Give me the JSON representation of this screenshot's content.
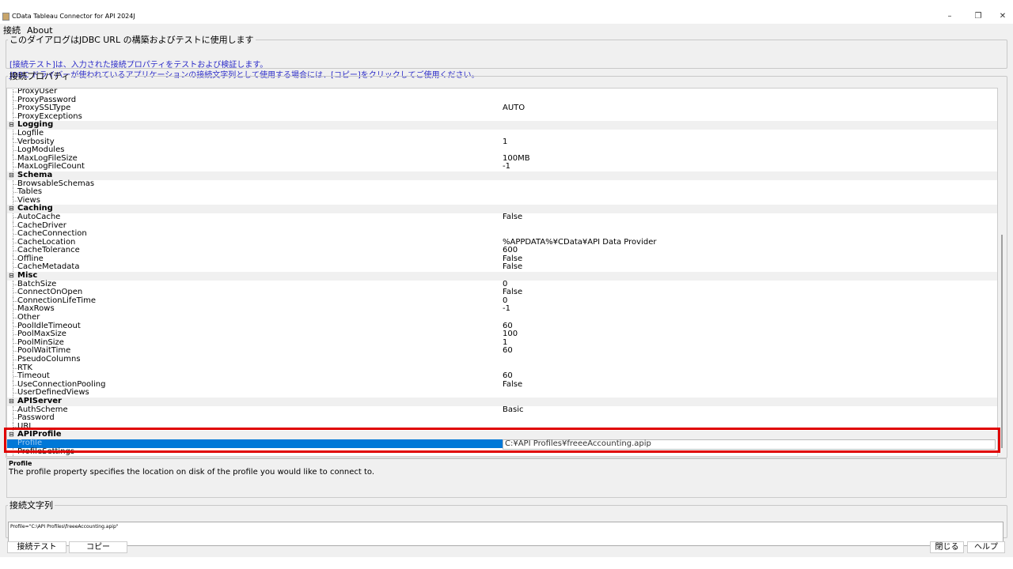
{
  "window": {
    "title": "CData Tableau Connector for API 2024J",
    "minimize": "–",
    "maximize": "❐",
    "close": "✕"
  },
  "menu": [
    "接続",
    "About"
  ],
  "info": {
    "legend": "このダイアログはJDBC URL の構築およびテストに使用します",
    "line1": "[接続テスト]は、入力された接続プロパティをテストおよび検証します。",
    "line2": "JDBC ドライバーが使われているアプリケーションの接続文字列として使用する場合には、[コピー]をクリックしてご使用ください。"
  },
  "properties": {
    "legend": "接続プロパティ",
    "rows": [
      {
        "name": "ProxyUser",
        "value": ""
      },
      {
        "name": "ProxyPassword",
        "value": ""
      },
      {
        "name": "ProxySSLType",
        "value": "AUTO"
      },
      {
        "name": "ProxyExceptions",
        "value": ""
      },
      {
        "name": "Logging",
        "category": true
      },
      {
        "name": "Logfile",
        "value": ""
      },
      {
        "name": "Verbosity",
        "value": "1"
      },
      {
        "name": "LogModules",
        "value": ""
      },
      {
        "name": "MaxLogFileSize",
        "value": "100MB"
      },
      {
        "name": "MaxLogFileCount",
        "value": "-1"
      },
      {
        "name": "Schema",
        "category": true
      },
      {
        "name": "BrowsableSchemas",
        "value": ""
      },
      {
        "name": "Tables",
        "value": ""
      },
      {
        "name": "Views",
        "value": ""
      },
      {
        "name": "Caching",
        "category": true
      },
      {
        "name": "AutoCache",
        "value": "False"
      },
      {
        "name": "CacheDriver",
        "value": ""
      },
      {
        "name": "CacheConnection",
        "value": ""
      },
      {
        "name": "CacheLocation",
        "value": "%APPDATA%¥CData¥API Data Provider"
      },
      {
        "name": "CacheTolerance",
        "value": "600"
      },
      {
        "name": "Offline",
        "value": "False"
      },
      {
        "name": "CacheMetadata",
        "value": "False"
      },
      {
        "name": "Misc",
        "category": true
      },
      {
        "name": "BatchSize",
        "value": "0"
      },
      {
        "name": "ConnectOnOpen",
        "value": "False"
      },
      {
        "name": "ConnectionLifeTime",
        "value": "0"
      },
      {
        "name": "MaxRows",
        "value": "-1"
      },
      {
        "name": "Other",
        "value": ""
      },
      {
        "name": "PoolIdleTimeout",
        "value": "60"
      },
      {
        "name": "PoolMaxSize",
        "value": "100"
      },
      {
        "name": "PoolMinSize",
        "value": "1"
      },
      {
        "name": "PoolWaitTime",
        "value": "60"
      },
      {
        "name": "PseudoColumns",
        "value": ""
      },
      {
        "name": "RTK",
        "value": ""
      },
      {
        "name": "Timeout",
        "value": "60"
      },
      {
        "name": "UseConnectionPooling",
        "value": "False"
      },
      {
        "name": "UserDefinedViews",
        "value": ""
      },
      {
        "name": "APIServer",
        "category": true
      },
      {
        "name": "AuthScheme",
        "value": "Basic"
      },
      {
        "name": "Password",
        "value": ""
      },
      {
        "name": "URL",
        "value": ""
      },
      {
        "name": "APIProfile",
        "category": true
      },
      {
        "name": "Profile",
        "value": "C:¥API Profiles¥freeeAccounting.apip",
        "selected": true
      },
      {
        "name": "ProfileSettings",
        "value": ""
      }
    ]
  },
  "description": {
    "heading": "Profile",
    "text": "The profile property specifies the location on disk of the profile you would like to connect to."
  },
  "connection_string": {
    "legend": "接続文字列",
    "value": "Profile=\"C:\\API Profiles\\freeeAccounting.apip\""
  },
  "buttons": {
    "test": "接続テスト",
    "copy": "コピー",
    "close": "閉じる",
    "help": "ヘルプ"
  },
  "colors": {
    "selection": "#0078d7",
    "highlight_box": "#e00000",
    "info_text": "#2b2bc8"
  }
}
